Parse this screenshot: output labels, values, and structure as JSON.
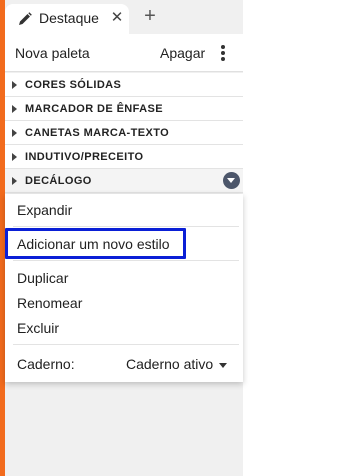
{
  "tab": {
    "icon": "pen-icon",
    "label": "Destaque",
    "close_glyph": "✕",
    "new_tab_glyph": "+"
  },
  "header": {
    "title": "Nova paleta",
    "clear_label": "Apagar",
    "more_icon": "kebab-menu-icon"
  },
  "categories": [
    {
      "label": "CORES SÓLIDAS"
    },
    {
      "label": "MARCADOR DE ÊNFASE"
    },
    {
      "label": "CANETAS MARCA-TEXTO"
    },
    {
      "label": "INDUTIVO/PRECEITO"
    },
    {
      "label": "DECÁLOGO",
      "selected": true
    }
  ],
  "menu": {
    "expand": "Expandir",
    "add_style": "Adicionar um novo estilo",
    "duplicate": "Duplicar",
    "rename": "Renomear",
    "delete": "Excluir",
    "notebook_label": "Caderno:",
    "notebook_value": "Caderno ativo"
  },
  "colors": {
    "accent_orange": "#f26b1d",
    "highlight_border": "#0a1fd6",
    "dropdown_badge": "#4c566a"
  }
}
